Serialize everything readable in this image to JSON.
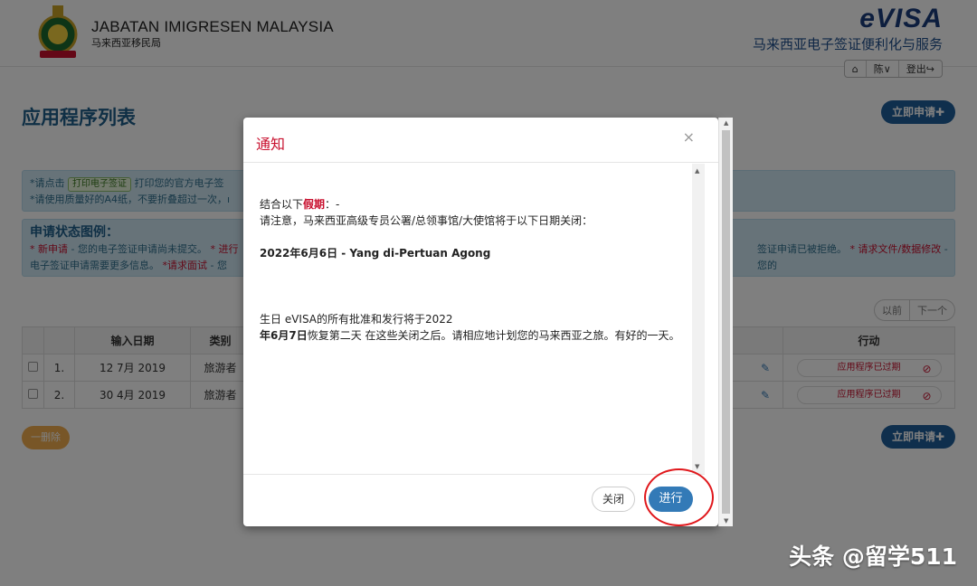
{
  "header": {
    "agency_en": "JABATAN IMIGRESEN MALAYSIA",
    "agency_zh": "马来西亚移民局",
    "logo_text": "eVISA",
    "subtitle": "马来西亚电子签证便利化与服务",
    "nav": {
      "user": "陈∨",
      "logout": "登出"
    }
  },
  "page": {
    "title": "应用程序列表",
    "apply_label": "立即申请✚",
    "info1_line1_prefix": "*请点击",
    "info1_tag": "打印电子签证",
    "info1_line1_suffix": "打印您的官方电子签",
    "info1_line2": "*请使用质量好的A4纸，不要折叠超过一次，ı",
    "legend_title": "申请状态图例：",
    "legend_new": "* 新申请",
    "legend_new_desc": " - 您的电子签证申请尚未提交。",
    "legend_in": " * 进行",
    "legend_desc_more": "电子签证申请需要更多信息。",
    "legend_interview": " *请求面试",
    "legend_interview_desc": " - 您",
    "legend_right1": "签证申请已被拒绝。",
    "legend_right2": " * 请求文件/数据修改",
    "legend_right3": " - 您的",
    "pager_prev": "以前",
    "pager_next": "下一个",
    "delete_label": "一删除"
  },
  "table": {
    "headers": {
      "date": "输入日期",
      "category": "类别",
      "action": "行动"
    },
    "rows": [
      {
        "no": "1.",
        "date": "12 7月 2019",
        "category": "旅游者",
        "status": "应用程序已过期"
      },
      {
        "no": "2.",
        "date": "30 4月 2019",
        "category": "旅游者",
        "status": "应用程序已过期"
      }
    ]
  },
  "modal": {
    "title": "通知",
    "line1_prefix": "结合以下",
    "line1_highlight": "假期",
    "line1_suffix": "：-",
    "line2": "请注意，马来西亚高级专员公署/总领事馆/大使馆将于以下日期关闭：",
    "holiday": "2022年6月6日 - Yang di-Pertuan Agong",
    "para_line1": "生日 eVISA的所有批准和发行将于2022",
    "para_bold": "年6月7日",
    "para_rest": "恢复第二天 在这些关闭之后。请相应地计划您的马来西亚之旅。有好的一天。",
    "close_label": "关闭",
    "proceed_label": "进行"
  },
  "watermark": "头条 @留学511",
  "colors": {
    "primary": "#337ab7",
    "title_red": "#c8102e",
    "header_blue": "#1f5f8b",
    "annotation_red": "#e0181c"
  }
}
